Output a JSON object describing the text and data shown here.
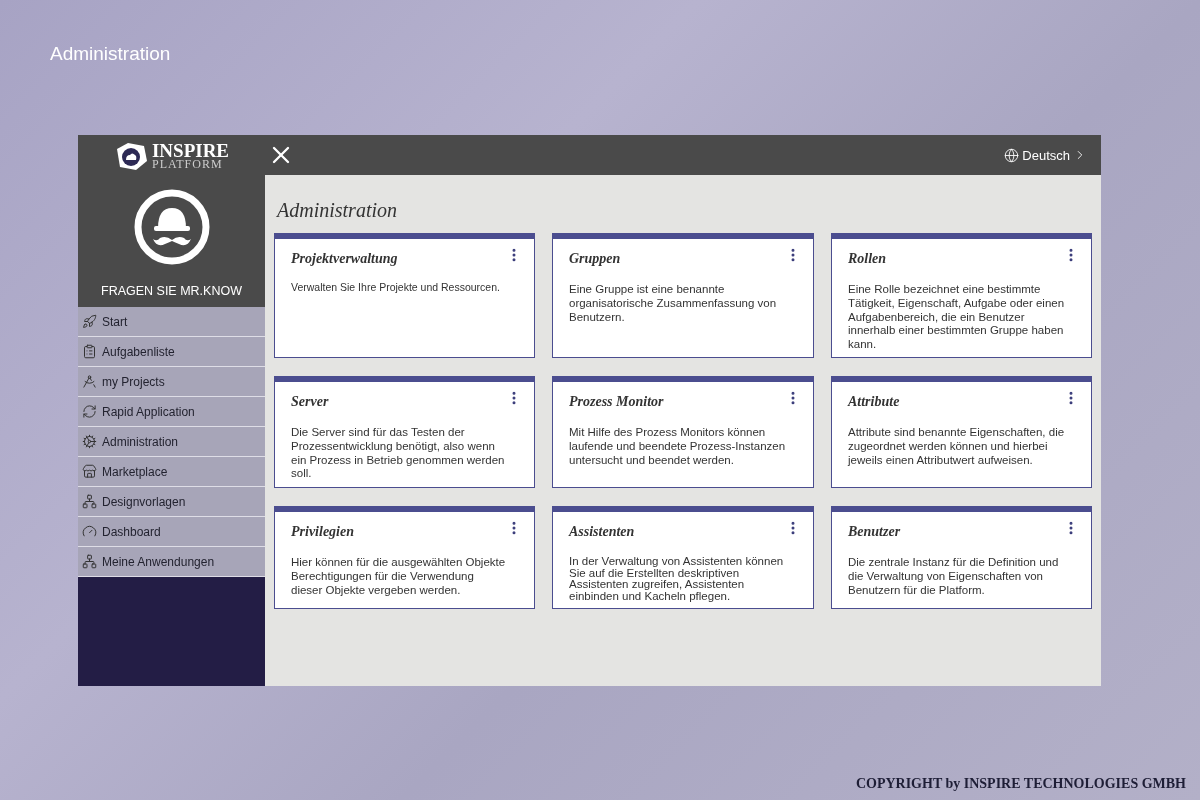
{
  "slide_title": "Administration",
  "logo": {
    "line1": "INSPIRE",
    "line2": "PLATFORM"
  },
  "assistant_label": "FRAGEN SIE MR.KNOW",
  "sidebar": {
    "items": [
      {
        "label": "Start"
      },
      {
        "label": "Aufgabenliste"
      },
      {
        "label": "my Projects"
      },
      {
        "label": "Rapid Application"
      },
      {
        "label": "Administration"
      },
      {
        "label": "Marketplace"
      },
      {
        "label": "Designvorlagen"
      },
      {
        "label": "Dashboard"
      },
      {
        "label": "Meine Anwendungen"
      }
    ]
  },
  "header": {
    "language": "Deutsch"
  },
  "page_title": "Administration",
  "cards": [
    {
      "title": "Projektverwaltung",
      "text": "Verwalten Sie Ihre Projekte und Ressourcen.",
      "kind": "compact"
    },
    {
      "title": "Gruppen",
      "text": "Eine Gruppe ist eine benannte organisatorische Zusammenfassung von Benutzern.",
      "kind": "normal"
    },
    {
      "title": "Rollen",
      "text": "Eine Rolle bezeichnet eine bestimmte Tätigkeit, Eigenschaft, Aufgabe oder einen Aufgabenbereich, die ein Benutzer innerhalb einer bestimmten Gruppe haben kann.",
      "kind": "normal"
    },
    {
      "title": "Server",
      "text": "Die Server sind für das Testen der Prozessentwicklung benötigt, also wenn ein Prozess in Betrieb genommen werden soll.",
      "kind": "normal"
    },
    {
      "title": "Prozess Monitor",
      "text": "Mit Hilfe des Prozess Monitors können laufende und beendete Prozess-Instanzen untersucht und beendet werden.",
      "kind": "normal"
    },
    {
      "title": "Attribute",
      "text": "Attribute sind benannte Eigenschaften, die zugeordnet werden können und hierbei jeweils einen Attributwert aufweisen.",
      "kind": "normal"
    },
    {
      "title": "Privilegien",
      "text": "Hier können für die ausgewählten Objekte Berechtigungen für die Verwendung dieser Objekte vergeben werden.",
      "kind": "normal"
    },
    {
      "title": "Assistenten",
      "text": "In der Verwaltung von Assistenten können Sie auf die Erstellten deskriptiven Assistenten zugreifen, Assistenten einbinden und Kacheln pflegen.",
      "kind": "dense"
    },
    {
      "title": "Benutzer",
      "text": "Die zentrale Instanz für die Definition und die Verwaltung von Eigenschaften von Benutzern für die Platform.",
      "kind": "normal"
    }
  ],
  "copyright": "COPYRIGHT by INSPIRE TECHNOLOGIES GMBH"
}
